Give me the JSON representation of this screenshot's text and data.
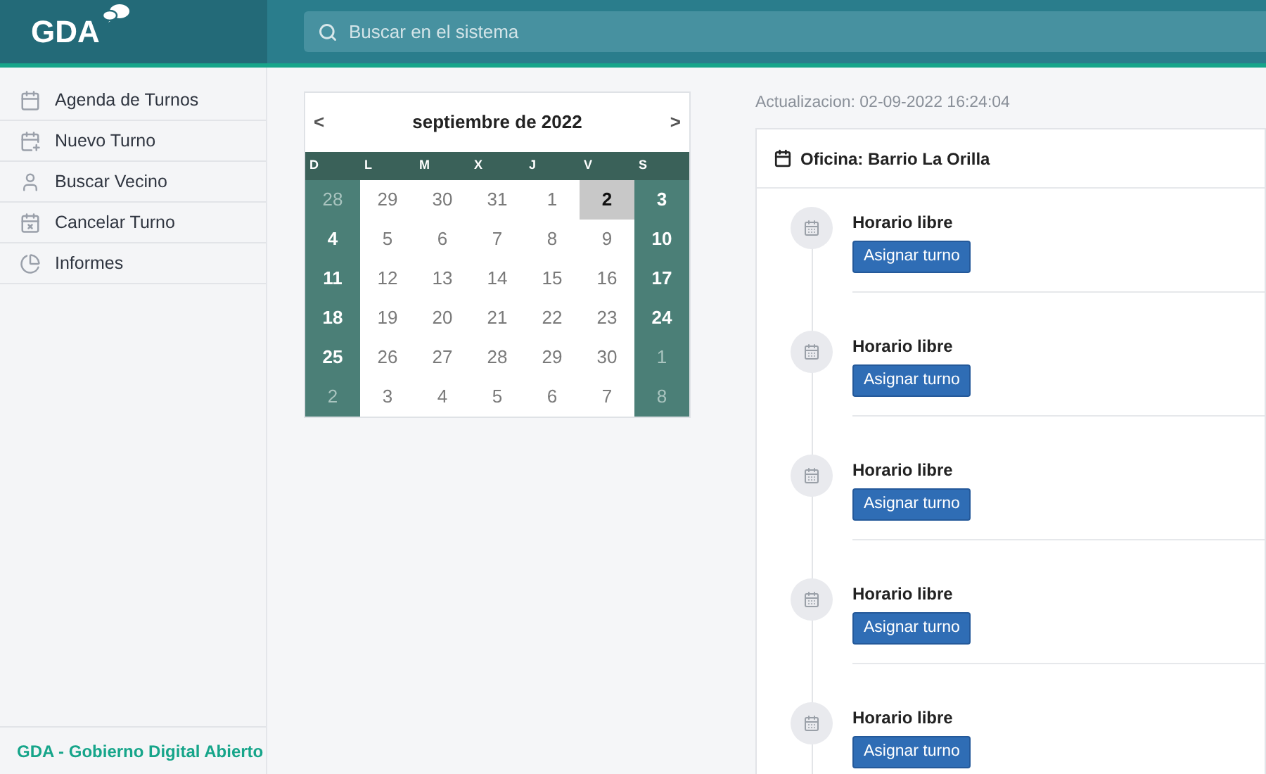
{
  "header": {
    "logo": "GDA",
    "search": {
      "placeholder": "Buscar en el sistema"
    }
  },
  "sidebar": {
    "items": [
      {
        "label": "Agenda de Turnos",
        "kind": "calendar",
        "selected": false
      },
      {
        "label": "Nuevo Turno",
        "kind": "new",
        "selected": false
      },
      {
        "label": "Buscar Vecino",
        "kind": "person",
        "selected": false
      },
      {
        "label": "Cancelar Turno",
        "kind": "cancel",
        "selected": false
      },
      {
        "label": "Informes",
        "kind": "chart",
        "selected": false
      }
    ],
    "footer": "GDA - Gobierno Digital Abierto"
  },
  "calendar": {
    "title": "septiembre de 2022",
    "prev": "<",
    "next": ">",
    "weekdays": [
      "D",
      "L",
      "M",
      "X",
      "J",
      "V",
      "S"
    ],
    "weeks": [
      [
        {
          "day": "28",
          "outside": true,
          "selected": false
        },
        {
          "day": "29",
          "outside": false,
          "selected": false
        },
        {
          "day": "30",
          "outside": false,
          "selected": false
        },
        {
          "day": "31",
          "outside": false,
          "selected": false
        },
        {
          "day": "1",
          "outside": false,
          "selected": false
        },
        {
          "day": "2",
          "outside": false,
          "selected": true
        },
        {
          "day": "3",
          "outside": false,
          "selected": false
        }
      ],
      [
        {
          "day": "4",
          "outside": false,
          "selected": false
        },
        {
          "day": "5",
          "outside": false,
          "selected": false
        },
        {
          "day": "6",
          "outside": false,
          "selected": false
        },
        {
          "day": "7",
          "outside": false,
          "selected": false
        },
        {
          "day": "8",
          "outside": false,
          "selected": false
        },
        {
          "day": "9",
          "outside": false,
          "selected": false
        },
        {
          "day": "10",
          "outside": false,
          "selected": false
        }
      ],
      [
        {
          "day": "11",
          "outside": false,
          "selected": false
        },
        {
          "day": "12",
          "outside": false,
          "selected": false
        },
        {
          "day": "13",
          "outside": false,
          "selected": false
        },
        {
          "day": "14",
          "outside": false,
          "selected": false
        },
        {
          "day": "15",
          "outside": false,
          "selected": false
        },
        {
          "day": "16",
          "outside": false,
          "selected": false
        },
        {
          "day": "17",
          "outside": false,
          "selected": false
        }
      ],
      [
        {
          "day": "18",
          "outside": false,
          "selected": false
        },
        {
          "day": "19",
          "outside": false,
          "selected": false
        },
        {
          "day": "20",
          "outside": false,
          "selected": false
        },
        {
          "day": "21",
          "outside": false,
          "selected": false
        },
        {
          "day": "22",
          "outside": false,
          "selected": false
        },
        {
          "day": "23",
          "outside": false,
          "selected": false
        },
        {
          "day": "24",
          "outside": false,
          "selected": false
        }
      ],
      [
        {
          "day": "25",
          "outside": false,
          "selected": false
        },
        {
          "day": "26",
          "outside": false,
          "selected": false
        },
        {
          "day": "27",
          "outside": false,
          "selected": false
        },
        {
          "day": "28",
          "outside": false,
          "selected": false
        },
        {
          "day": "29",
          "outside": false,
          "selected": false
        },
        {
          "day": "30",
          "outside": false,
          "selected": false
        },
        {
          "day": "1",
          "outside": true,
          "selected": false
        }
      ],
      [
        {
          "day": "2",
          "outside": true,
          "selected": false
        },
        {
          "day": "3",
          "outside": false,
          "selected": false
        },
        {
          "day": "4",
          "outside": false,
          "selected": false
        },
        {
          "day": "5",
          "outside": false,
          "selected": false
        },
        {
          "day": "6",
          "outside": false,
          "selected": false
        },
        {
          "day": "7",
          "outside": false,
          "selected": false
        },
        {
          "day": "8",
          "outside": true,
          "selected": false
        }
      ]
    ]
  },
  "updated": "Actualizacion: 02-09-2022 16:24:04",
  "office": {
    "title": "Oficina: Barrio La Orilla",
    "slots": [
      {
        "title": "Horario libre",
        "button": "Asignar turno"
      },
      {
        "title": "Horario libre",
        "button": "Asignar turno"
      },
      {
        "title": "Horario libre",
        "button": "Asignar turno"
      },
      {
        "title": "Horario libre",
        "button": "Asignar turno"
      },
      {
        "title": "Horario libre",
        "button": "Asignar turno"
      }
    ]
  }
}
